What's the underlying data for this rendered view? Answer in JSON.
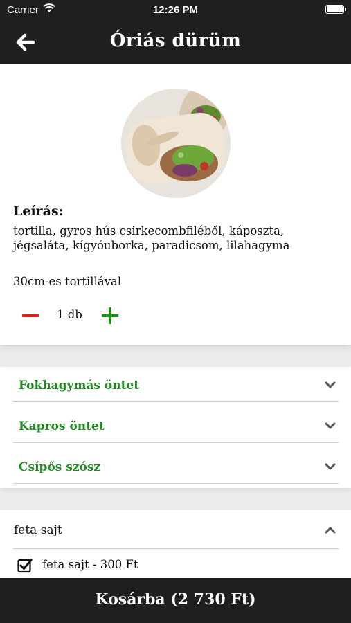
{
  "status_bar": {
    "carrier": "Carrier",
    "time": "12:26 PM"
  },
  "header": {
    "title": "Óriás dürüm",
    "back_icon": "arrow-left-icon"
  },
  "product": {
    "image_icon": "durum-wrap-photo",
    "description_title": "Leírás:",
    "description": "tortilla, gyros hús csirkecombfiléből, káposzta, jégsaláta, kígyóuborka, paradicsom, lilahagyma",
    "size_note": "30cm-es tortillával",
    "quantity_label": "1 db"
  },
  "options": [
    {
      "label": "Fokhagymás öntet"
    },
    {
      "label": "Kapros öntet"
    },
    {
      "label": "Csípős szósz"
    }
  ],
  "extras": {
    "group_label": "feta sajt",
    "items": [
      {
        "label": "feta sajt - 300 Ft",
        "checked": true
      }
    ]
  },
  "cart": {
    "button_label": "Kosárba (2 730 Ft)"
  },
  "colors": {
    "bar_background": "#1f1f1f",
    "option_green": "#1f8a1f",
    "minus_red": "#e31b1b",
    "plus_green": "#179217"
  }
}
